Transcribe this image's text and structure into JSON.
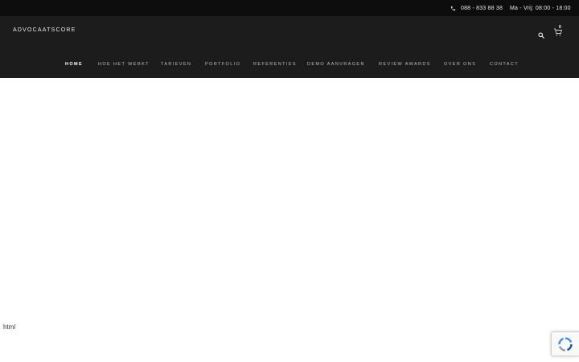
{
  "topbar": {
    "phone": "088 - 833 88 38",
    "hours": "Ma - Vrij: 08:00 - 18:00"
  },
  "header": {
    "logo": "ADVOCAATSCORE",
    "cart_count": "0"
  },
  "nav": {
    "items": [
      {
        "label": "Home"
      },
      {
        "label": "Hoe het werkt"
      },
      {
        "label": "Tarieven"
      },
      {
        "label": "Portfolio"
      },
      {
        "label": "Referenties"
      },
      {
        "label": "Demo aanvragen"
      },
      {
        "label": "Review Awards"
      },
      {
        "label": "Over ons"
      },
      {
        "label": "Contact"
      }
    ]
  },
  "page": {
    "label": "html"
  },
  "colors": {
    "topbar_bg": "#0d0d0d",
    "header_bg": "#1c1c1c",
    "nav_text": "#bdbdbd",
    "active_text": "#ffffff",
    "recaptcha_blue": "#4a90e2"
  },
  "icons": {
    "phone": "phone-icon",
    "search": "search-icon",
    "cart": "cart-icon",
    "recaptcha": "recaptcha-icon"
  }
}
